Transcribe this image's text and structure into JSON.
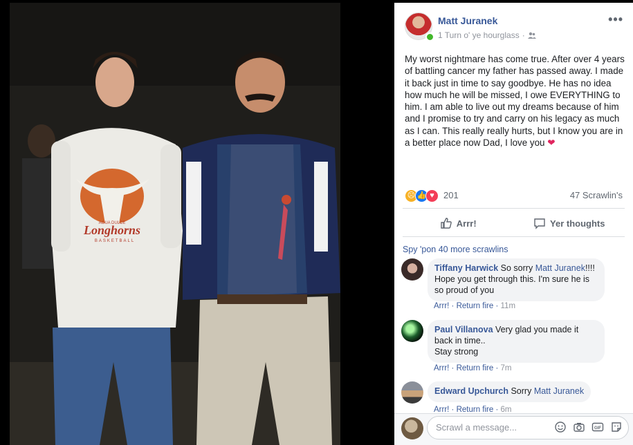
{
  "post": {
    "author": "Matt Juranek",
    "meta": "1 Turn o' ye hourglass",
    "more": "•••",
    "text": "My worst nightmare has come true. After over 4 years of battling cancer my father has passed away. I made it back just in time to say goodbye. He has no idea how much he will be missed, I owe EVERYTHING to him. I am able to live out my dreams because of him and I promise to try and carry on his legacy as much as I can. This really really hurts, but I know you are in a better place now Dad, I love you",
    "heart": "❤",
    "reaction_count": "201",
    "share_count": "47 Scrawlin's"
  },
  "actions": {
    "like": "Arrr!",
    "comment": "Yer thoughts"
  },
  "comments_section": {
    "more_link": "Spy 'pon 40 more scrawlins",
    "items": [
      {
        "name": "Tiffany Harwick",
        "text_before": "So sorry",
        "mention": "Matt Juranek",
        "text_after": "!!!! Hope you get through this. I'm sure he is so proud of you",
        "like": "Arrr!",
        "reply": "Return fire",
        "time": "11m"
      },
      {
        "name": "Paul Villanova",
        "text_before": "Very glad you made it back in time..",
        "mention": "",
        "text_after": "Stay strong",
        "like": "Arrr!",
        "reply": "Return fire",
        "time": "7m"
      },
      {
        "name": "Edward Upchurch",
        "text_before": "Sorry",
        "mention": "Matt Juranek",
        "text_after": "",
        "like": "Arrr!",
        "reply": "Return fire",
        "time": "6m"
      }
    ]
  },
  "composer": {
    "placeholder": "Scrawl a message..."
  },
  "photo": {
    "shirt_text": "Longhorns",
    "shirt_subtext": "BASKETBALL",
    "shirt_top": "AGUA DULCE"
  },
  "colors": {
    "link": "#385898",
    "online": "#42b72a",
    "heart": "#e0245e"
  }
}
